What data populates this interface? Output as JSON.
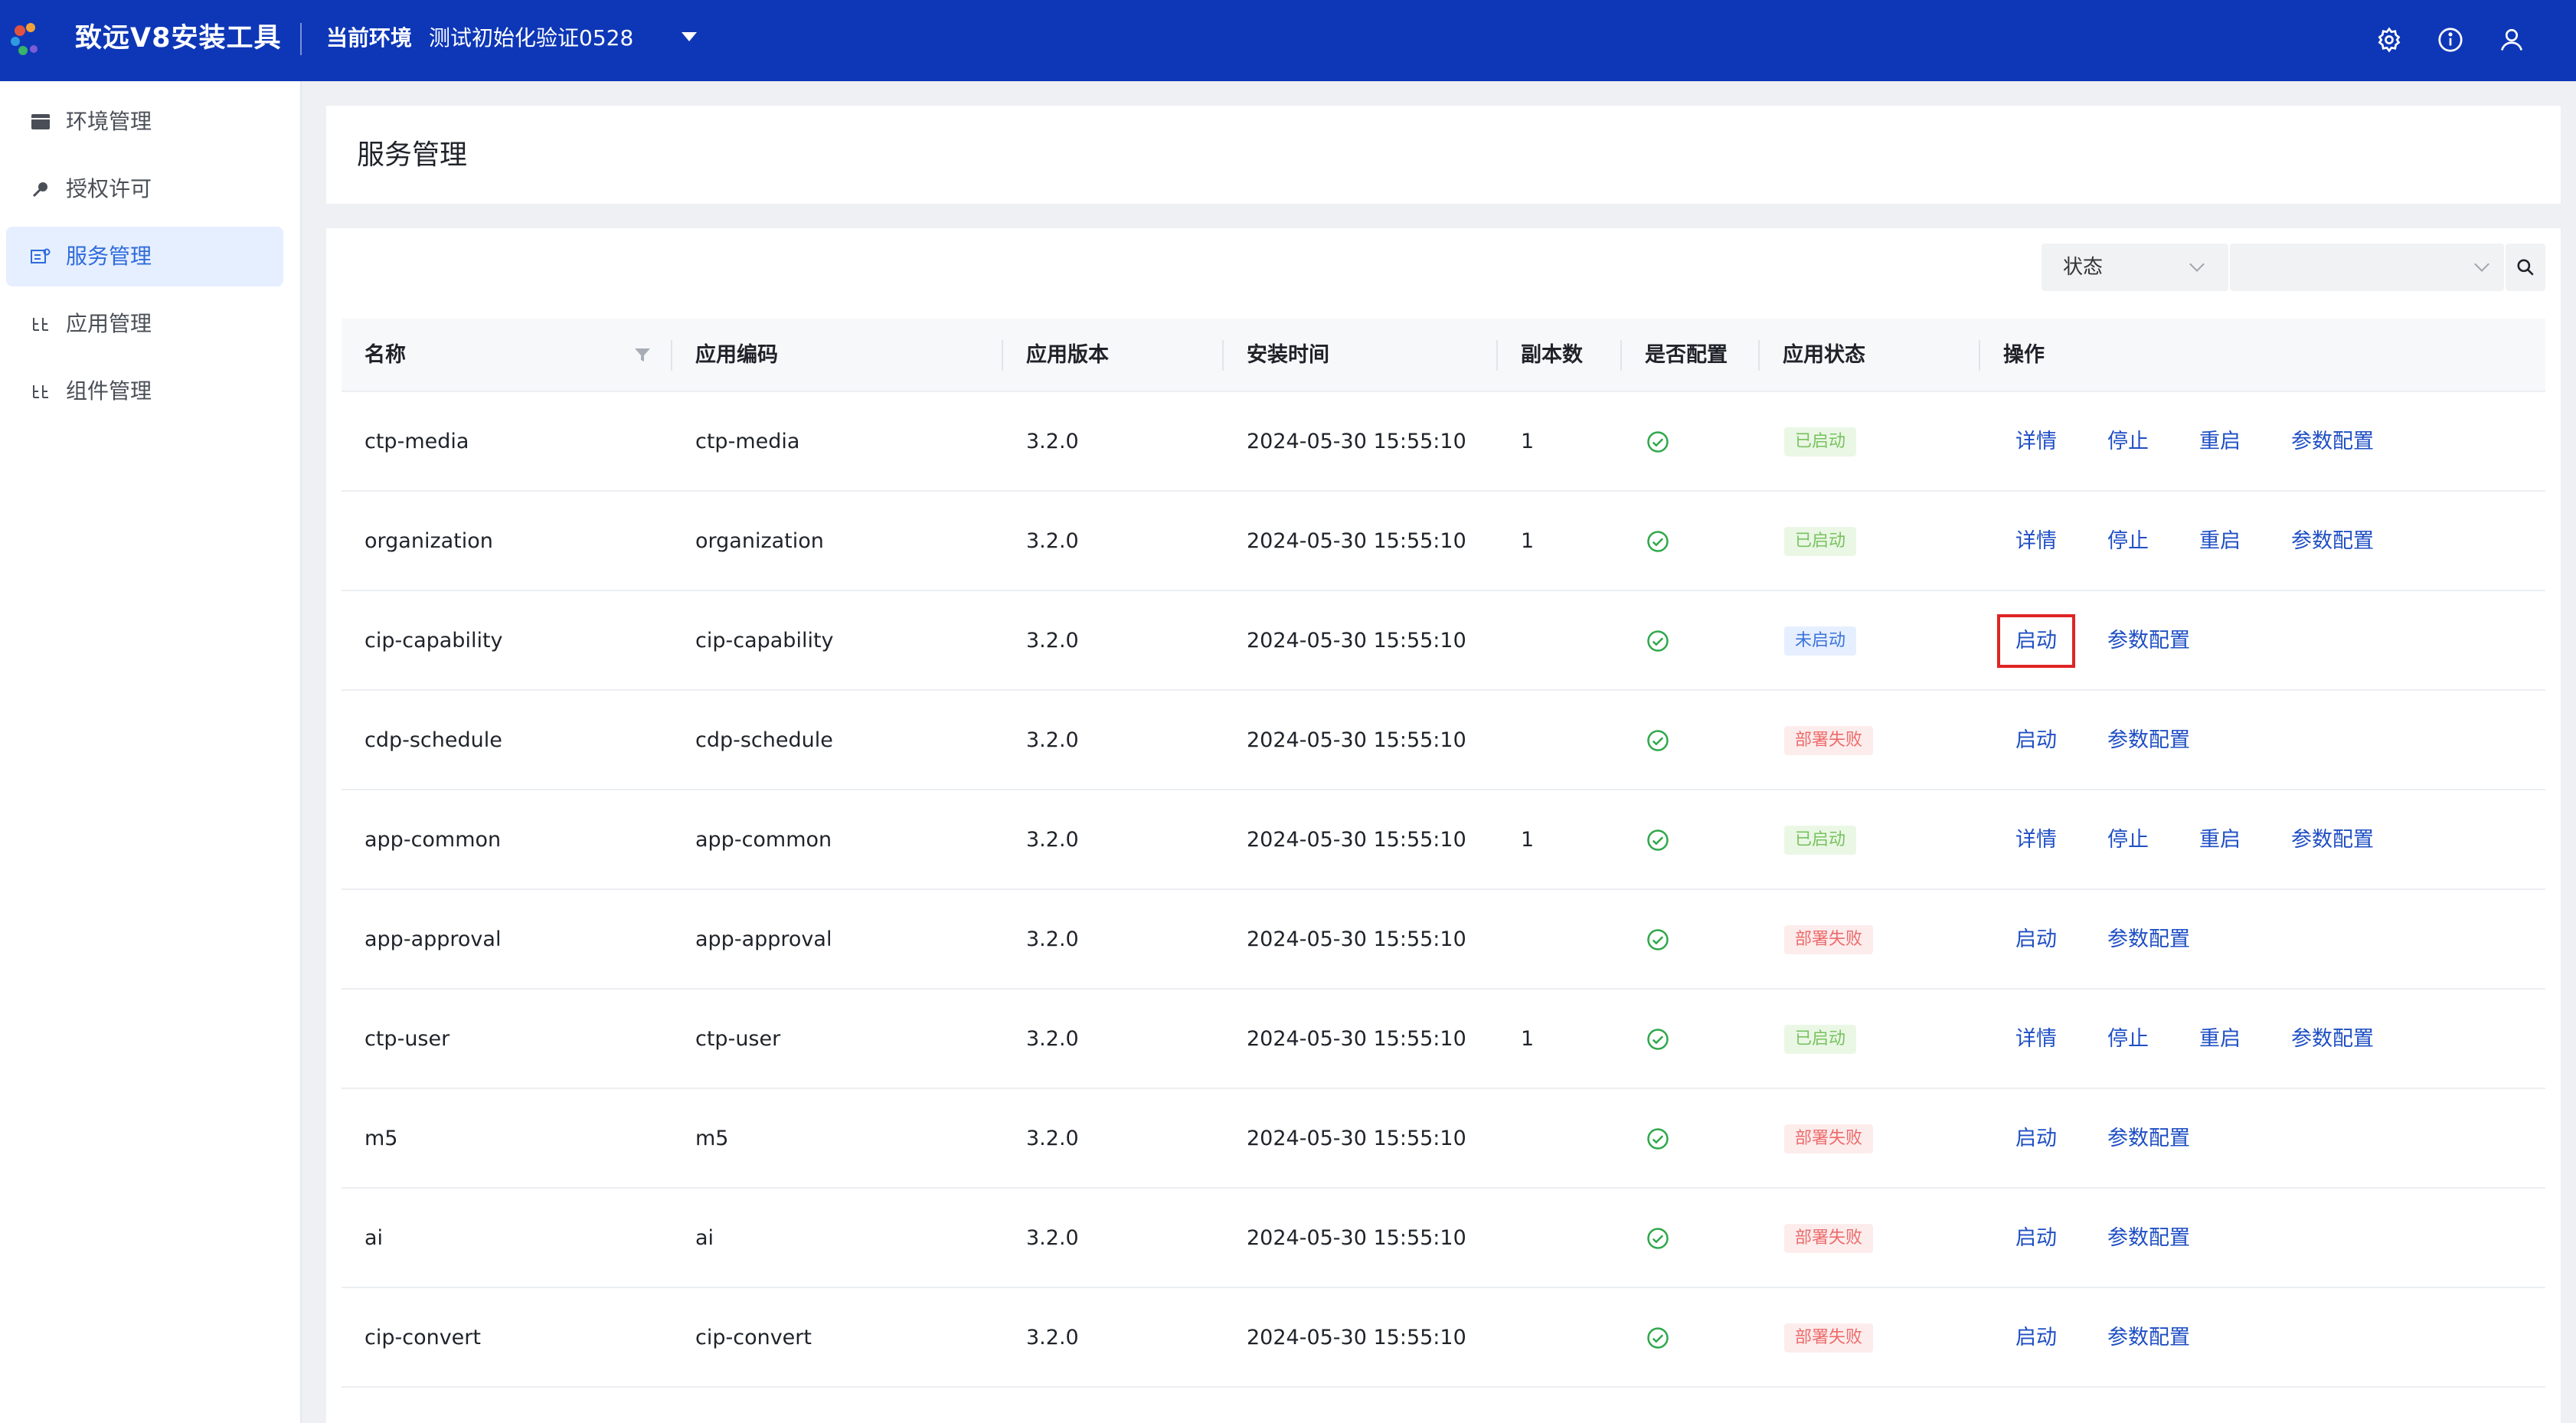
{
  "header": {
    "app_title": "致远V8安装工具",
    "env_label": "当前环境",
    "env_value": "测试初始化验证0528",
    "icons": [
      "gear-icon",
      "info-icon",
      "user-icon"
    ]
  },
  "sidebar": {
    "items": [
      {
        "label": "环境管理",
        "icon": "folder-icon",
        "active": false
      },
      {
        "label": "授权许可",
        "icon": "key-icon",
        "active": false
      },
      {
        "label": "服务管理",
        "icon": "service-icon",
        "active": true
      },
      {
        "label": "应用管理",
        "icon": "app-icon",
        "active": false
      },
      {
        "label": "组件管理",
        "icon": "component-icon",
        "active": false
      }
    ]
  },
  "page": {
    "title": "服务管理"
  },
  "filters": {
    "status_label": "状态",
    "status_select_value": ""
  },
  "table": {
    "columns": [
      "名称",
      "应用编码",
      "应用版本",
      "安装时间",
      "副本数",
      "是否配置",
      "应用状态",
      "操作"
    ],
    "rows": [
      {
        "name": "ctp-media",
        "code": "ctp-media",
        "version": "3.2.0",
        "time": "2024-05-30 15:55:10",
        "replicas": "1",
        "status": "已启动",
        "status_type": "started",
        "actions": [
          "详情",
          "停止",
          "重启",
          "参数配置"
        ]
      },
      {
        "name": "organization",
        "code": "organization",
        "version": "3.2.0",
        "time": "2024-05-30 15:55:10",
        "replicas": "1",
        "status": "已启动",
        "status_type": "started",
        "actions": [
          "详情",
          "停止",
          "重启",
          "参数配置"
        ]
      },
      {
        "name": "cip-capability",
        "code": "cip-capability",
        "version": "3.2.0",
        "time": "2024-05-30 15:55:10",
        "replicas": "",
        "status": "未启动",
        "status_type": "notstarted",
        "actions": [
          "启动",
          "参数配置"
        ],
        "highlight_first": true
      },
      {
        "name": "cdp-schedule",
        "code": "cdp-schedule",
        "version": "3.2.0",
        "time": "2024-05-30 15:55:10",
        "replicas": "",
        "status": "部署失败",
        "status_type": "failed",
        "actions": [
          "启动",
          "参数配置"
        ]
      },
      {
        "name": "app-common",
        "code": "app-common",
        "version": "3.2.0",
        "time": "2024-05-30 15:55:10",
        "replicas": "1",
        "status": "已启动",
        "status_type": "started",
        "actions": [
          "详情",
          "停止",
          "重启",
          "参数配置"
        ]
      },
      {
        "name": "app-approval",
        "code": "app-approval",
        "version": "3.2.0",
        "time": "2024-05-30 15:55:10",
        "replicas": "",
        "status": "部署失败",
        "status_type": "failed",
        "actions": [
          "启动",
          "参数配置"
        ]
      },
      {
        "name": "ctp-user",
        "code": "ctp-user",
        "version": "3.2.0",
        "time": "2024-05-30 15:55:10",
        "replicas": "1",
        "status": "已启动",
        "status_type": "started",
        "actions": [
          "详情",
          "停止",
          "重启",
          "参数配置"
        ]
      },
      {
        "name": "m5",
        "code": "m5",
        "version": "3.2.0",
        "time": "2024-05-30 15:55:10",
        "replicas": "",
        "status": "部署失败",
        "status_type": "failed",
        "actions": [
          "启动",
          "参数配置"
        ]
      },
      {
        "name": "ai",
        "code": "ai",
        "version": "3.2.0",
        "time": "2024-05-30 15:55:10",
        "replicas": "",
        "status": "部署失败",
        "status_type": "failed",
        "actions": [
          "启动",
          "参数配置"
        ]
      },
      {
        "name": "cip-convert",
        "code": "cip-convert",
        "version": "3.2.0",
        "time": "2024-05-30 15:55:10",
        "replicas": "",
        "status": "部署失败",
        "status_type": "failed",
        "actions": [
          "启动",
          "参数配置"
        ]
      }
    ]
  },
  "colors": {
    "header_bg": "#0e37b7",
    "link": "#1f4fc4",
    "highlight_border": "#e02424",
    "ok_green": "#2ea84a"
  }
}
